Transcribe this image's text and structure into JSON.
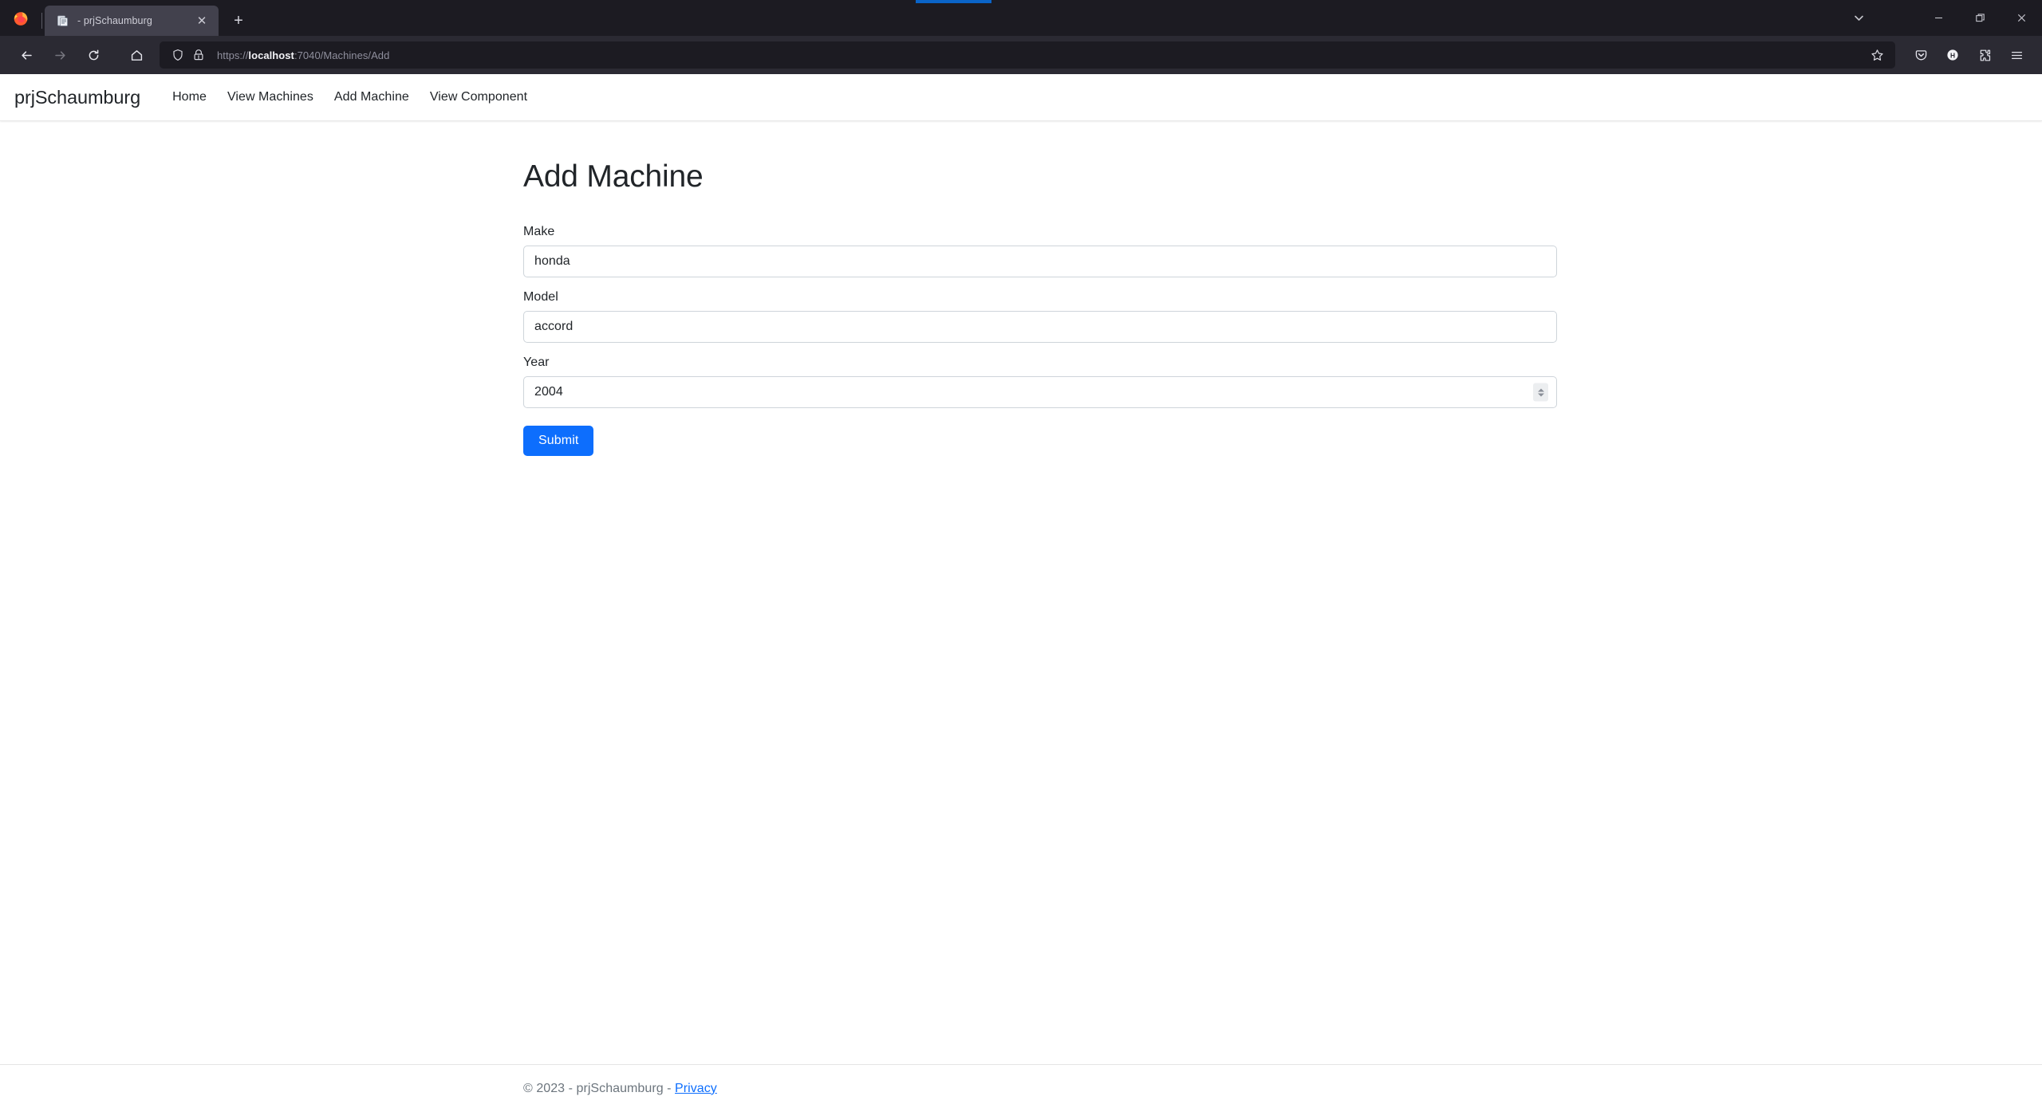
{
  "browser": {
    "tab": {
      "title": "- prjSchaumburg",
      "favicon_name": "document-favicon",
      "close_glyph": "✕"
    },
    "new_tab_glyph": "+",
    "window_controls": {
      "tab_list": "chevron-down-icon",
      "minimize": "minimize-icon",
      "restore": "restore-icon",
      "close": "close-icon"
    },
    "toolbar": {
      "back": "back-arrow-icon",
      "forward": "forward-arrow-icon",
      "reload": "reload-icon",
      "home": "home-icon",
      "shield": "shield-icon",
      "lock": "lock-warning-icon",
      "bookmark": "star-icon",
      "pocket": "pocket-icon",
      "account": "account-h-icon",
      "extensions": "extensions-icon",
      "app_menu": "hamburger-menu-icon"
    },
    "url": {
      "scheme": "https://",
      "host": "localhost",
      "path": ":7040/Machines/Add",
      "full": "https://localhost:7040/Machines/Add"
    }
  },
  "site": {
    "brand": "prjSchaumburg",
    "nav": [
      {
        "label": "Home"
      },
      {
        "label": "View Machines"
      },
      {
        "label": "Add Machine"
      },
      {
        "label": "View Component"
      }
    ]
  },
  "page": {
    "title": "Add Machine",
    "form": {
      "fields": [
        {
          "label": "Make",
          "value": "honda",
          "type": "text"
        },
        {
          "label": "Model",
          "value": "accord",
          "type": "text"
        },
        {
          "label": "Year",
          "value": "2004",
          "type": "number"
        }
      ],
      "submit_label": "Submit"
    }
  },
  "footer": {
    "text": "© 2023 - prjSchaumburg - ",
    "link_label": "Privacy"
  },
  "colors": {
    "primary": "#0d6efd",
    "chrome_top": "#1c1b22",
    "chrome_nav": "#2b2a33",
    "tab_active": "#42414d",
    "text": "#212529",
    "muted": "#6c757d"
  }
}
